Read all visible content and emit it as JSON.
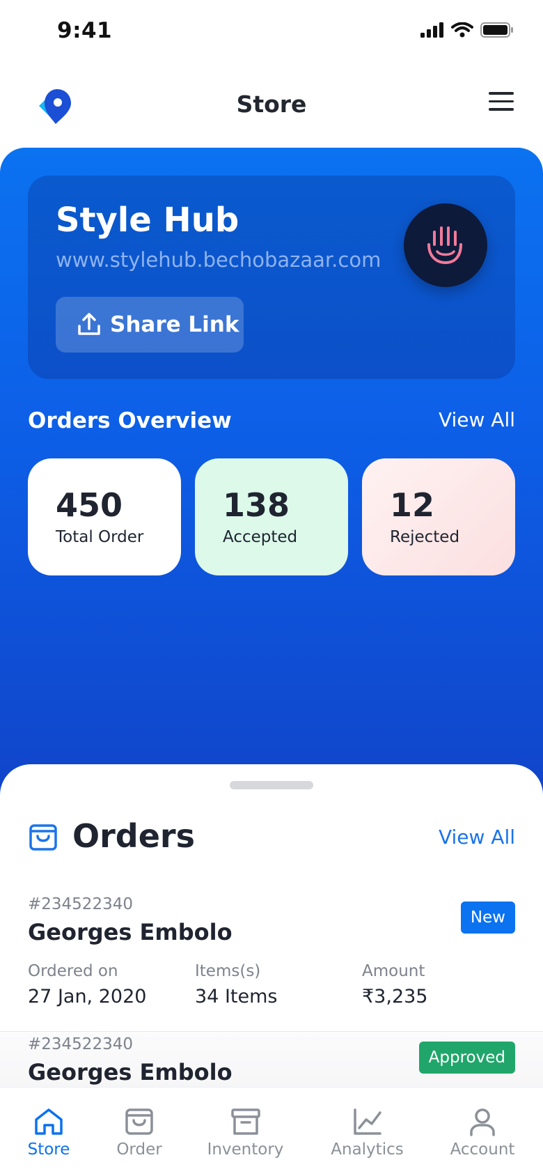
{
  "status_bar": {
    "time": "9:41"
  },
  "header": {
    "title": "Store"
  },
  "store": {
    "name": "Style Hub",
    "url": "www.stylehub.bechobazaar.com",
    "share_label": "Share Link"
  },
  "overview": {
    "title": "Orders Overview",
    "view_all": "View All",
    "stats": [
      {
        "value": "450",
        "label": "Total Order"
      },
      {
        "value": "138",
        "label": "Accepted"
      },
      {
        "value": "12",
        "label": "Rejected"
      }
    ]
  },
  "orders": {
    "title": "Orders",
    "view_all": "View All",
    "columns": [
      "Ordered on",
      "Items(s)",
      "Amount"
    ],
    "items": [
      {
        "id": "#234522340",
        "name": "Georges Embolo",
        "status": "New",
        "date": "27 Jan, 2020",
        "items": "34 Items",
        "amount": "₹3,235"
      },
      {
        "id": "#234522340",
        "name": "Georges Embolo",
        "status": "Approved"
      }
    ]
  },
  "nav": {
    "items": [
      {
        "label": "Store",
        "icon": "home-icon",
        "active": true
      },
      {
        "label": "Order",
        "icon": "bag-icon",
        "active": false
      },
      {
        "label": "Inventory",
        "icon": "archive-icon",
        "active": false
      },
      {
        "label": "Analytics",
        "icon": "chart-line-icon",
        "active": false
      },
      {
        "label": "Account",
        "icon": "user-icon",
        "active": false
      }
    ]
  },
  "colors": {
    "primary": "#0b72f0",
    "approved": "#20a66a",
    "accepted_bg": "#dcf9ea",
    "rejected_bg": "#fbdfe0"
  }
}
